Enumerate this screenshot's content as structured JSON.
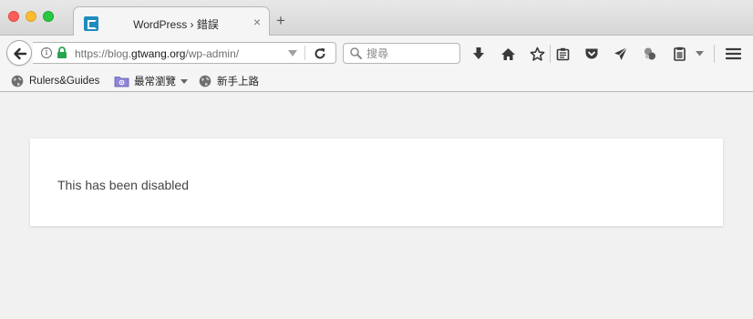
{
  "window": {
    "tab": {
      "title": "WordPress › 錯誤",
      "close_glyph": "×"
    },
    "new_tab_glyph": "+"
  },
  "navbar": {
    "url": {
      "prefix": "https://blog.",
      "host": "gtwang.org",
      "path": "/wp-admin/"
    },
    "search": {
      "placeholder": "搜尋",
      "value": ""
    }
  },
  "toolbar_icons": [
    "download-icon",
    "home-icon",
    "bookmark-star-icon",
    "reading-list-icon",
    "pocket-icon",
    "send-icon",
    "extension-icon",
    "clipboard-icon",
    "overflow-chevron-icon",
    "hamburger-menu-icon"
  ],
  "bookmarks": [
    {
      "label": "Rulers&Guides",
      "icon": "globe-icon"
    },
    {
      "label": "最常瀏覽",
      "icon": "smart-folder-icon",
      "has_menu": true
    },
    {
      "label": "新手上路",
      "icon": "globe-icon"
    }
  ],
  "page": {
    "message": "This has been disabled"
  },
  "colors": {
    "wp_blue": "#1e8cbe",
    "secure_lock": "#2aa44f",
    "page_background": "#f1f1f1"
  }
}
